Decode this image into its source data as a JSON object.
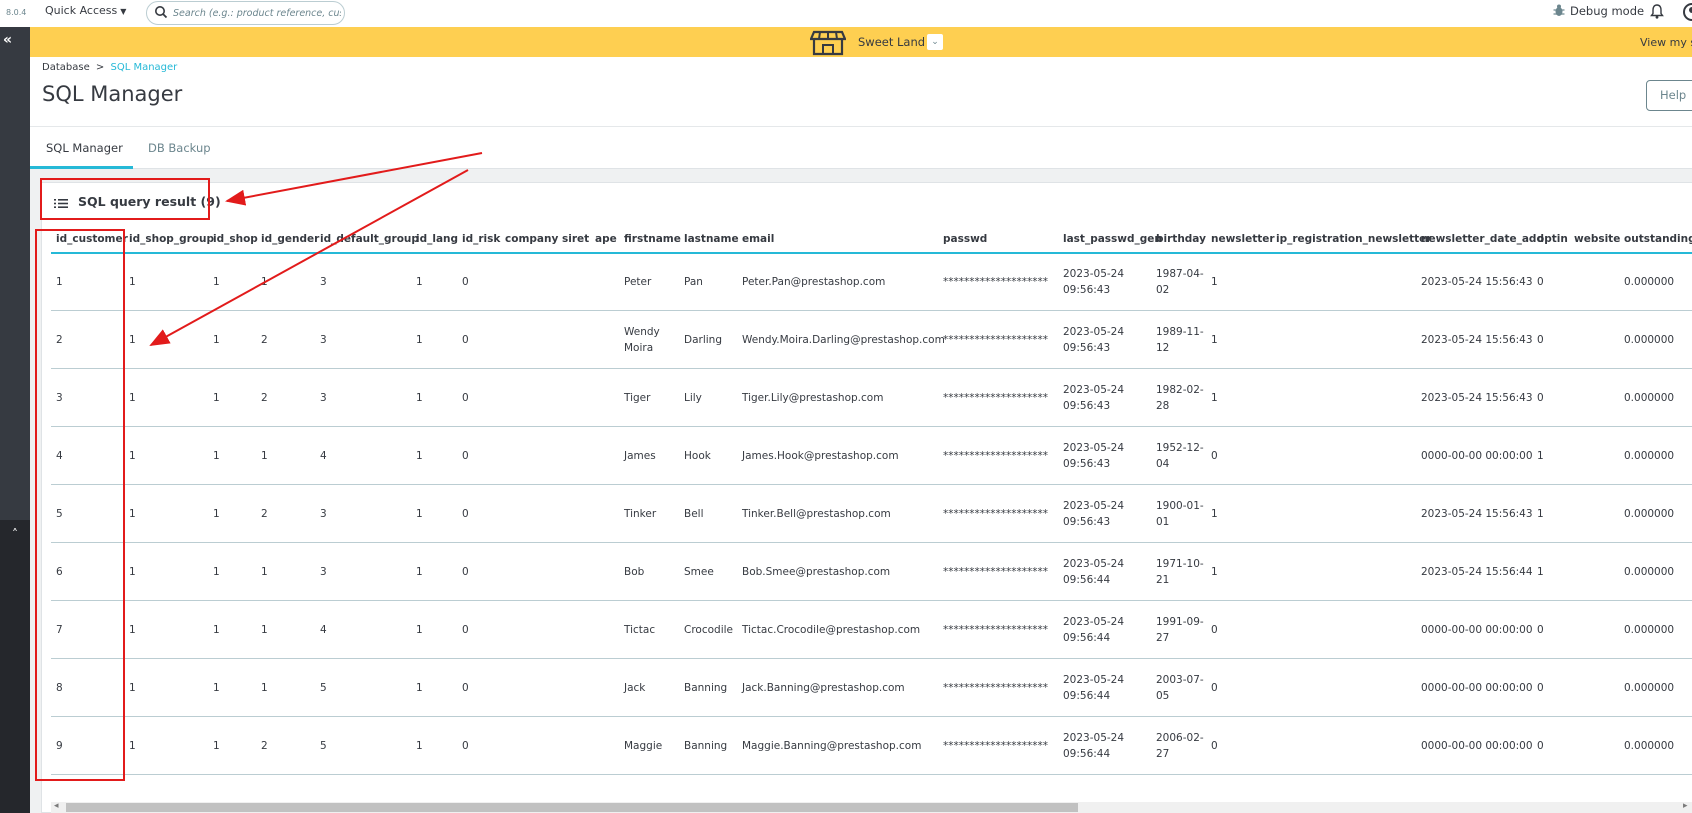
{
  "topbar": {
    "version": "8.0.4",
    "quick_access": "Quick Access",
    "search_placeholder": "Search (e.g.: product reference, custon",
    "debug_mode": "Debug mode"
  },
  "shop": {
    "name": "Sweet Land",
    "view_my_shop": "View my shop"
  },
  "breadcrumb": {
    "parent": "Database",
    "separator": ">",
    "current": "SQL Manager"
  },
  "page_title": "SQL Manager",
  "help_button": "Help",
  "tabs": [
    {
      "label": "SQL Manager"
    },
    {
      "label": "DB Backup"
    }
  ],
  "card_title": "SQL query result (9)",
  "table": {
    "columns": [
      "id_customer",
      "id_shop_group",
      "id_shop",
      "id_gender",
      "id_default_group",
      "id_lang",
      "id_risk",
      "company",
      "siret",
      "ape",
      "firstname",
      "lastname",
      "email",
      "passwd",
      "last_passwd_gen",
      "birthday",
      "newsletter",
      "ip_registration_newsletter",
      "newsletter_date_add",
      "optin",
      "website",
      "outstanding_"
    ],
    "rows": [
      {
        "id_customer": "1",
        "id_shop_group": "1",
        "id_shop": "1",
        "id_gender": "1",
        "id_default_group": "3",
        "id_lang": "1",
        "id_risk": "0",
        "firstname_1": "Peter",
        "firstname_2": "",
        "lastname": "Pan",
        "email": "Peter.Pan@prestashop.com",
        "passwd": "********************",
        "last_passwd_gen_1": "2023-05-24",
        "last_passwd_gen_2": "09:56:43",
        "birthday_1": "1987-04-",
        "birthday_2": "02",
        "newsletter": "1",
        "newsletter_date_add": "2023-05-24 15:56:43",
        "optin": "0",
        "outstanding": "0.000000"
      },
      {
        "id_customer": "2",
        "id_shop_group": "1",
        "id_shop": "1",
        "id_gender": "2",
        "id_default_group": "3",
        "id_lang": "1",
        "id_risk": "0",
        "firstname_1": "Wendy",
        "firstname_2": "Moira",
        "lastname": "Darling",
        "email": "Wendy.Moira.Darling@prestashop.com",
        "passwd": "********************",
        "last_passwd_gen_1": "2023-05-24",
        "last_passwd_gen_2": "09:56:43",
        "birthday_1": "1989-11-",
        "birthday_2": "12",
        "newsletter": "1",
        "newsletter_date_add": "2023-05-24 15:56:43",
        "optin": "0",
        "outstanding": "0.000000"
      },
      {
        "id_customer": "3",
        "id_shop_group": "1",
        "id_shop": "1",
        "id_gender": "2",
        "id_default_group": "3",
        "id_lang": "1",
        "id_risk": "0",
        "firstname_1": "Tiger",
        "firstname_2": "",
        "lastname": "Lily",
        "email": "Tiger.Lily@prestashop.com",
        "passwd": "********************",
        "last_passwd_gen_1": "2023-05-24",
        "last_passwd_gen_2": "09:56:43",
        "birthday_1": "1982-02-",
        "birthday_2": "28",
        "newsletter": "1",
        "newsletter_date_add": "2023-05-24 15:56:43",
        "optin": "0",
        "outstanding": "0.000000"
      },
      {
        "id_customer": "4",
        "id_shop_group": "1",
        "id_shop": "1",
        "id_gender": "1",
        "id_default_group": "4",
        "id_lang": "1",
        "id_risk": "0",
        "firstname_1": "James",
        "firstname_2": "",
        "lastname": "Hook",
        "email": "James.Hook@prestashop.com",
        "passwd": "********************",
        "last_passwd_gen_1": "2023-05-24",
        "last_passwd_gen_2": "09:56:43",
        "birthday_1": "1952-12-",
        "birthday_2": "04",
        "newsletter": "0",
        "newsletter_date_add": "0000-00-00 00:00:00",
        "optin": "1",
        "outstanding": "0.000000"
      },
      {
        "id_customer": "5",
        "id_shop_group": "1",
        "id_shop": "1",
        "id_gender": "2",
        "id_default_group": "3",
        "id_lang": "1",
        "id_risk": "0",
        "firstname_1": "Tinker",
        "firstname_2": "",
        "lastname": "Bell",
        "email": "Tinker.Bell@prestashop.com",
        "passwd": "********************",
        "last_passwd_gen_1": "2023-05-24",
        "last_passwd_gen_2": "09:56:43",
        "birthday_1": "1900-01-",
        "birthday_2": "01",
        "newsletter": "1",
        "newsletter_date_add": "2023-05-24 15:56:43",
        "optin": "1",
        "outstanding": "0.000000"
      },
      {
        "id_customer": "6",
        "id_shop_group": "1",
        "id_shop": "1",
        "id_gender": "1",
        "id_default_group": "3",
        "id_lang": "1",
        "id_risk": "0",
        "firstname_1": "Bob",
        "firstname_2": "",
        "lastname": "Smee",
        "email": "Bob.Smee@prestashop.com",
        "passwd": "********************",
        "last_passwd_gen_1": "2023-05-24",
        "last_passwd_gen_2": "09:56:44",
        "birthday_1": "1971-10-",
        "birthday_2": "21",
        "newsletter": "1",
        "newsletter_date_add": "2023-05-24 15:56:44",
        "optin": "1",
        "outstanding": "0.000000"
      },
      {
        "id_customer": "7",
        "id_shop_group": "1",
        "id_shop": "1",
        "id_gender": "1",
        "id_default_group": "4",
        "id_lang": "1",
        "id_risk": "0",
        "firstname_1": "Tictac",
        "firstname_2": "",
        "lastname": "Crocodile",
        "email": "Tictac.Crocodile@prestashop.com",
        "passwd": "********************",
        "last_passwd_gen_1": "2023-05-24",
        "last_passwd_gen_2": "09:56:44",
        "birthday_1": "1991-09-",
        "birthday_2": "27",
        "newsletter": "0",
        "newsletter_date_add": "0000-00-00 00:00:00",
        "optin": "0",
        "outstanding": "0.000000"
      },
      {
        "id_customer": "8",
        "id_shop_group": "1",
        "id_shop": "1",
        "id_gender": "1",
        "id_default_group": "5",
        "id_lang": "1",
        "id_risk": "0",
        "firstname_1": "Jack",
        "firstname_2": "",
        "lastname": "Banning",
        "email": "Jack.Banning@prestashop.com",
        "passwd": "********************",
        "last_passwd_gen_1": "2023-05-24",
        "last_passwd_gen_2": "09:56:44",
        "birthday_1": "2003-07-",
        "birthday_2": "05",
        "newsletter": "0",
        "newsletter_date_add": "0000-00-00 00:00:00",
        "optin": "0",
        "outstanding": "0.000000"
      },
      {
        "id_customer": "9",
        "id_shop_group": "1",
        "id_shop": "1",
        "id_gender": "2",
        "id_default_group": "5",
        "id_lang": "1",
        "id_risk": "0",
        "firstname_1": "Maggie",
        "firstname_2": "",
        "lastname": "Banning",
        "email": "Maggie.Banning@prestashop.com",
        "passwd": "********************",
        "last_passwd_gen_1": "2023-05-24",
        "last_passwd_gen_2": "09:56:44",
        "birthday_1": "2006-02-",
        "birthday_2": "27",
        "newsletter": "0",
        "newsletter_date_add": "0000-00-00 00:00:00",
        "optin": "0",
        "outstanding": "0.000000"
      }
    ]
  },
  "colors": {
    "accent": "#25b9d7",
    "shopbar": "#fecf51",
    "annotation_red": "#e21b1b",
    "sidebar": "#363a41"
  },
  "icons": {
    "search": "search-icon",
    "debug": "bug-icon",
    "bell": "bell-icon",
    "profile": "user-icon",
    "store": "store-icon",
    "list": "list-icon",
    "collapse": "double-chevron-left-icon"
  }
}
